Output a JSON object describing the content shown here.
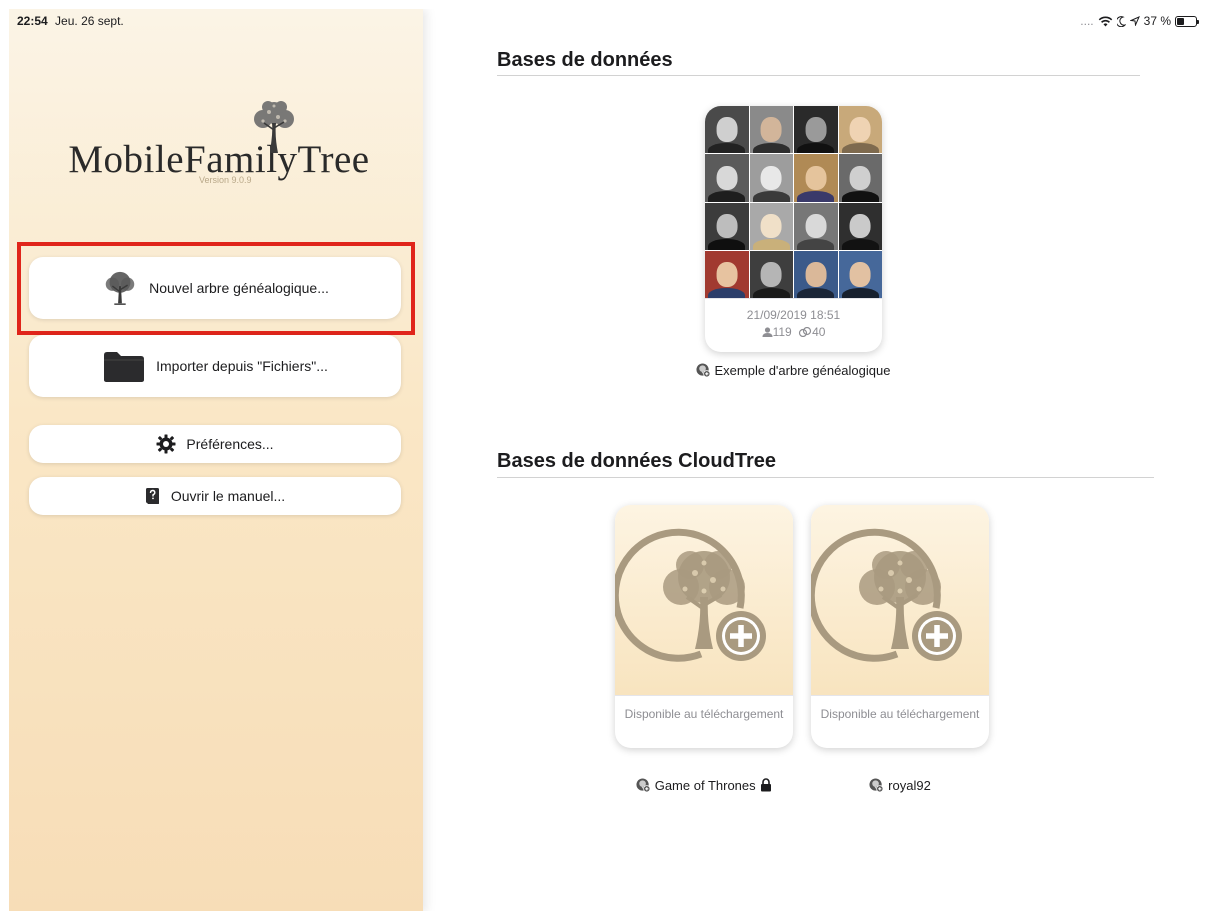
{
  "status_bar": {
    "time": "22:54",
    "date": "Jeu. 26 sept.",
    "signal": "....",
    "battery_percent": "37 %",
    "battery_level": 0.37
  },
  "sidebar": {
    "app_name": "MobileFamilyTree",
    "version": "Version 9.0.9",
    "buttons": {
      "new_tree": "Nouvel arbre généalogique...",
      "import_files": "Importer depuis \"Fichiers\"...",
      "preferences": "Préférences...",
      "manual": "Ouvrir le manuel..."
    }
  },
  "databases": {
    "title": "Bases de données",
    "items": [
      {
        "date": "21/09/2019 18:51",
        "persons": "119",
        "families": "40",
        "name": "Exemple d'arbre généalogique"
      }
    ]
  },
  "cloudtree": {
    "title": "Bases de données CloudTree",
    "items": [
      {
        "status": "Disponible au téléchargement",
        "name": "Game of Thrones",
        "locked": true
      },
      {
        "status": "Disponible au téléchargement",
        "name": "royal92",
        "locked": false
      }
    ]
  },
  "colors": {
    "highlight": "#e0251b",
    "tree_icon": "#a99a80",
    "sidebar_gradient_top": "#fbf4e6",
    "sidebar_gradient_bottom": "#f7ddb7"
  }
}
